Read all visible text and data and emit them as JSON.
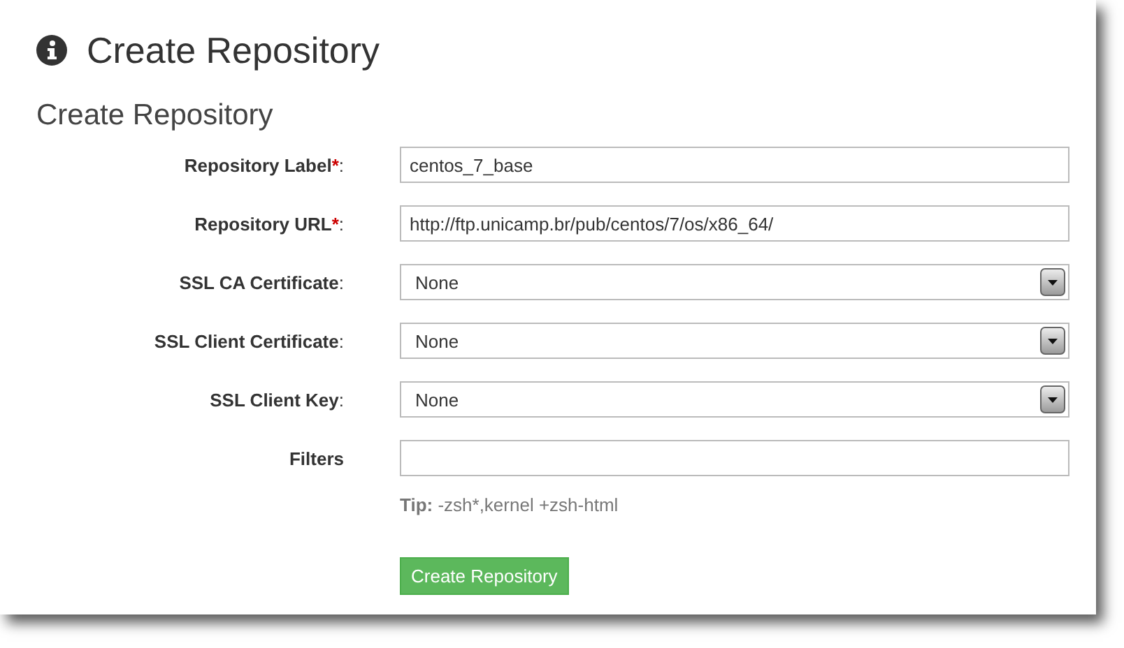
{
  "page": {
    "title": "Create Repository"
  },
  "form": {
    "title": "Create Repository",
    "fields": [
      {
        "kind": "text",
        "label": "Repository Label",
        "required_mark": "*",
        "suffix": ":",
        "value": "centos_7_base"
      },
      {
        "kind": "text",
        "label": "Repository URL",
        "required_mark": "*",
        "suffix": ":",
        "value": "http://ftp.unicamp.br/pub/centos/7/os/x86_64/"
      },
      {
        "kind": "select",
        "label": "SSL CA Certificate",
        "suffix": ":",
        "value": "None"
      },
      {
        "kind": "select",
        "label": "SSL Client Certificate",
        "suffix": ":",
        "value": "None"
      },
      {
        "kind": "select",
        "label": "SSL Client Key",
        "suffix": ":",
        "value": "None"
      },
      {
        "kind": "text",
        "label": "Filters"
      }
    ],
    "tip": "**Tip:** -zsh*,kernel +zsh-html",
    "submit": "Create Repository"
  }
}
